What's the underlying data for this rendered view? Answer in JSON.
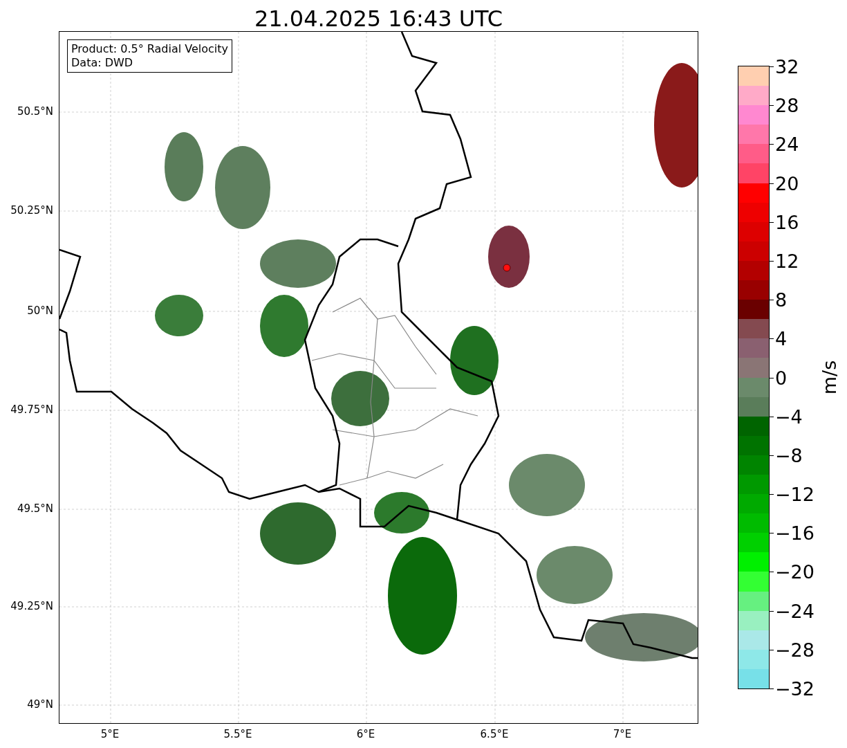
{
  "title": "21.04.2025 16:43 UTC",
  "info_box": [
    "Product: 0.5° Radial Velocity",
    "Data: DWD"
  ],
  "y_ticks": [
    "50.5°N",
    "50.25°N",
    "50°N",
    "49.75°N",
    "49.5°N",
    "49.25°N",
    "49°N"
  ],
  "x_ticks": [
    "5°E",
    "5.5°E",
    "6°E",
    "6.5°E",
    "7°E"
  ],
  "colorbar": {
    "label": "m/s",
    "ticks": [
      "32",
      "28",
      "24",
      "20",
      "16",
      "12",
      "8",
      "4",
      "0",
      "−4",
      "−8",
      "−12",
      "−16",
      "−20",
      "−24",
      "−28",
      "−32"
    ]
  }
}
